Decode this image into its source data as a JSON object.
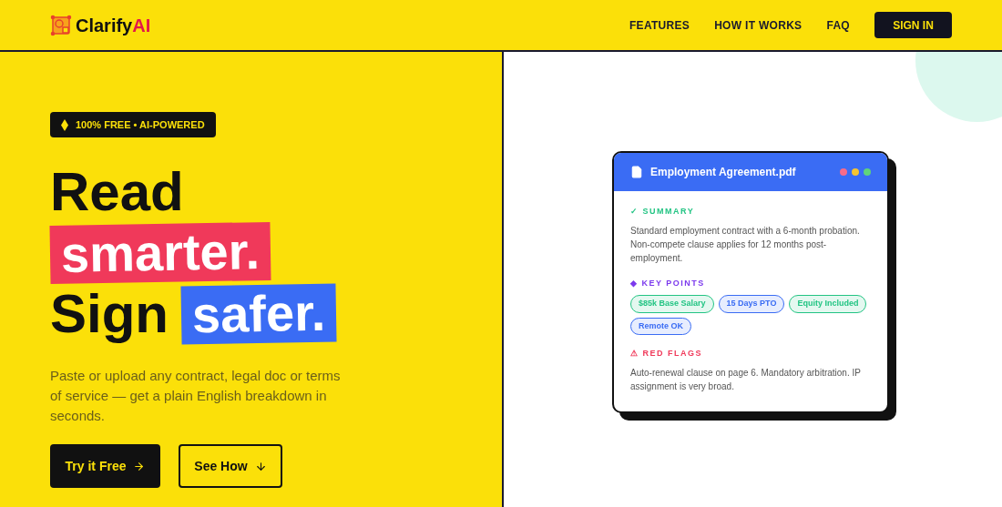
{
  "brand": {
    "name": "Clarify",
    "accent": "AI"
  },
  "nav": {
    "links": [
      "FEATURES",
      "HOW IT WORKS",
      "FAQ"
    ],
    "signin": "SIGN IN"
  },
  "hero": {
    "badge": "100% FREE • AI-POWERED",
    "headline": [
      [
        {
          "text": "Read",
          "kind": "plain"
        }
      ],
      [
        {
          "text": "smarter.",
          "kind": "highlighted",
          "color": "#f0395a"
        }
      ],
      [
        {
          "text": "Sign",
          "kind": "plain"
        },
        {
          "text": "safer.",
          "kind": "highlighted",
          "color": "#3a6cf4"
        }
      ]
    ],
    "description": "Paste or upload any contract, legal doc or terms of service — get a plain English breakdown in seconds.",
    "buttons": [
      {
        "label": "Try it Free",
        "kind": "primary"
      },
      {
        "label": "See How",
        "kind": "secondary"
      }
    ]
  },
  "document": {
    "title": "Employment Agreement.pdf",
    "dots": [
      {
        "color": "#f76b8a"
      },
      {
        "color": "#f5c431"
      },
      {
        "color": "#5fd37a"
      }
    ],
    "sections": [
      {
        "kind": "text",
        "heading": "✓ SUMMARY",
        "color": "#22c483",
        "text": "Standard employment contract with a 6-month probation. Non-compete clause applies for 12 months post-employment."
      },
      {
        "kind": "tags",
        "heading": "◆ KEY POINTS",
        "color": "#7c3aed",
        "tags": [
          {
            "label": "$85k Base Salary",
            "color": "#22c483"
          },
          {
            "label": "15 Days PTO",
            "color": "#3a6cf4"
          },
          {
            "label": "Equity Included",
            "color": "#22c483"
          },
          {
            "label": "Remote OK",
            "color": "#3a6cf4"
          }
        ]
      },
      {
        "kind": "text",
        "heading": "⚠ RED FLAGS",
        "color": "#f0395a",
        "text": "Auto-renewal clause on page 6. Mandatory arbitration. IP assignment is very broad."
      }
    ]
  }
}
